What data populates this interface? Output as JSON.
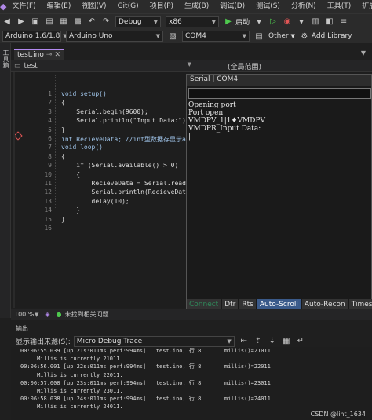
{
  "menu": {
    "items": [
      "文件(F)",
      "编辑(E)",
      "视图(V)",
      "Git(G)",
      "项目(P)",
      "生成(B)",
      "调试(D)",
      "测试(S)",
      "分析(N)",
      "工具(T)",
      "扩展(X)"
    ]
  },
  "toolbar": {
    "config": "Debug",
    "platform": "x86",
    "start_label": "启动",
    "board_version": "Arduino 1.6/1.8",
    "board": "Arduino Uno",
    "port": "COM4",
    "other": "Other",
    "add_library": "Add Library"
  },
  "left_panel": {
    "label": "工具箱"
  },
  "editor": {
    "tab": "test.ino",
    "scope_left": "test",
    "scope_right": "(全局范围)",
    "lines": [
      {
        "n": "1",
        "text": "void setup()"
      },
      {
        "n": "2",
        "text": "{"
      },
      {
        "n": "3",
        "text": "    Serial.begin(9600);"
      },
      {
        "n": "4",
        "text": "    Serial.println(\"Input Data:\");"
      },
      {
        "n": "5",
        "text": "}"
      },
      {
        "n": "6",
        "text": "int RecieveData; //int型数据存显示ascii"
      },
      {
        "n": "7",
        "text": "void loop()"
      },
      {
        "n": "8",
        "text": "{"
      },
      {
        "n": "9",
        "text": "    if (Serial.available() > 0)"
      },
      {
        "n": "10",
        "text": "    {"
      },
      {
        "n": "11",
        "text": "        RecieveData = Serial.read();"
      },
      {
        "n": "12",
        "text": "        Serial.println(RecieveData);"
      },
      {
        "n": "13",
        "text": "        delay(10);"
      },
      {
        "n": "14",
        "text": "    }"
      },
      {
        "n": "15",
        "text": "}"
      },
      {
        "n": "16",
        "text": ""
      }
    ]
  },
  "serial_monitor": {
    "title": "Serial | COM4",
    "output": "Opening port\nPort open\nVMDPV_1|1♦VMDPV\nVMDPR_Input Data:\n|",
    "buttons": [
      "Connect",
      "Dtr",
      "Rts",
      "Auto-Scroll",
      "Auto-Recon",
      "Times"
    ]
  },
  "status_bar": {
    "zoom": "100 %",
    "issues": "未找到相关问题"
  },
  "output_panel": {
    "title": "输出",
    "source_label": "显示输出来源(S):",
    "source_value": "Micro Debug Trace",
    "lines": [
      "00:06:55.039 [up:21s:011ms perf:994ms]   test.ino, 行 8       millis()=21011",
      "     Millis is currently 21011.",
      "00:06:56.001 [up:22s:011ms perf:994ms]   test.ino, 行 8       millis()=22011",
      "     Millis is currently 22011.",
      "00:06:57.008 [up:23s:011ms perf:994ms]   test.ino, 行 8       millis()=23011",
      "     Millis is currently 23011.",
      "00:06:58.038 [up:24s:011ms perf:994ms]   test.ino, 行 8       millis()=24011",
      "     Millis is currently 24011."
    ]
  },
  "watermark": "CSDN @liht_1634"
}
